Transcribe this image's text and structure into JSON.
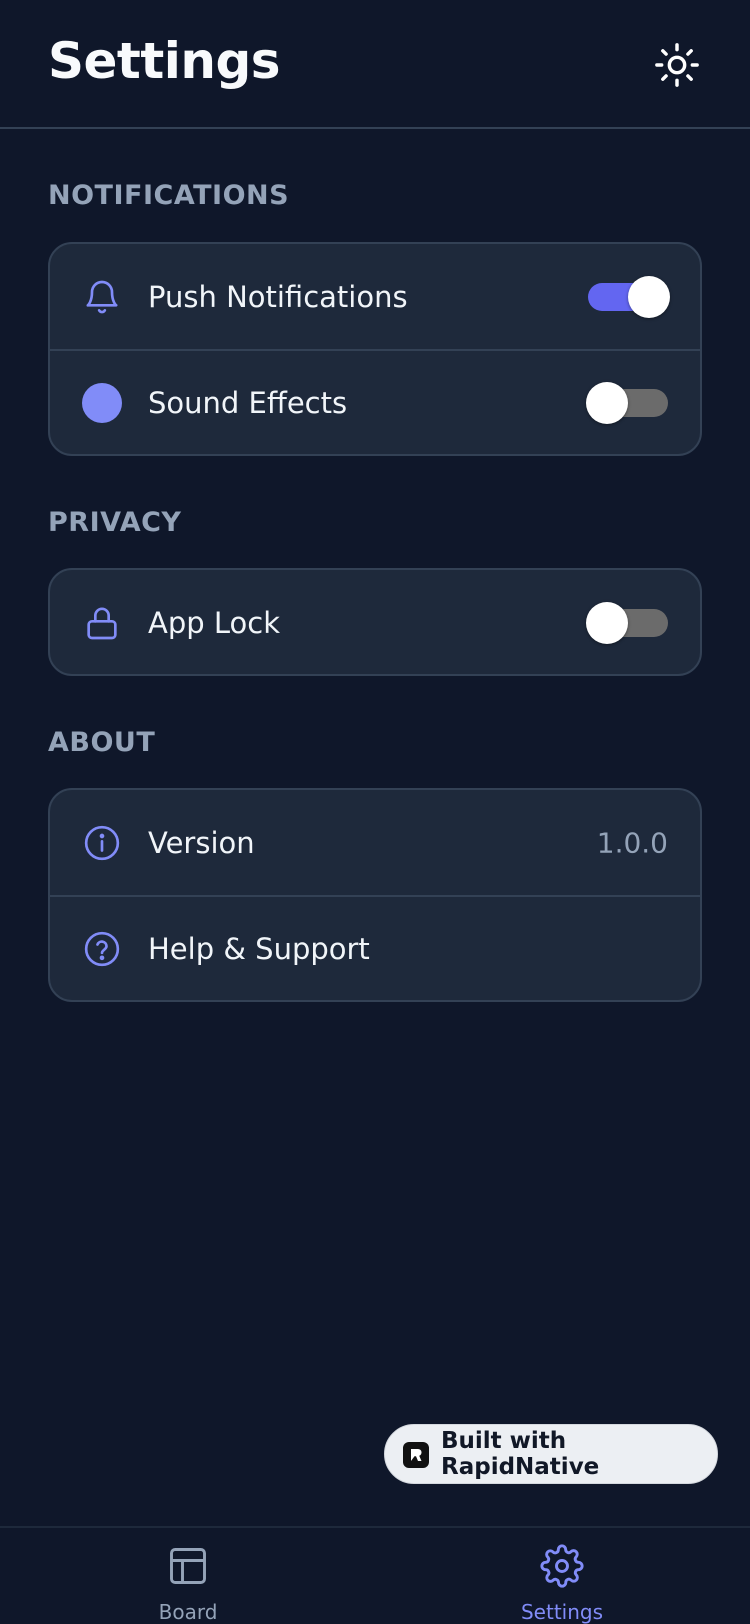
{
  "header": {
    "title": "Settings",
    "theme_icon": "sun-icon"
  },
  "sections": {
    "notifications": {
      "label": "NOTIFICATIONS",
      "rows": [
        {
          "label": "Push Notifications",
          "icon": "bell-icon",
          "toggle": true
        },
        {
          "label": "Sound Effects",
          "icon": "dot-icon",
          "toggle": false
        }
      ]
    },
    "privacy": {
      "label": "PRIVACY",
      "rows": [
        {
          "label": "App Lock",
          "icon": "lock-icon",
          "toggle": false
        }
      ]
    },
    "about": {
      "label": "ABOUT",
      "rows": [
        {
          "label": "Version",
          "icon": "info-icon",
          "value": "1.0.0"
        },
        {
          "label": "Help & Support",
          "icon": "help-icon"
        }
      ]
    }
  },
  "badge": {
    "text": "Built with RapidNative",
    "icon": "rapidnative-logo-icon"
  },
  "tabbar": {
    "tabs": [
      {
        "label": "Board",
        "icon": "layout-icon",
        "active": false
      },
      {
        "label": "Settings",
        "icon": "gear-icon",
        "active": true
      }
    ]
  },
  "colors": {
    "background": "#0f172a",
    "card": "#1e293b",
    "border": "#334155",
    "accent": "#818cf8",
    "toggle_on": "#6366f1",
    "toggle_off": "#6b6b6b",
    "muted": "#94a3b8"
  }
}
